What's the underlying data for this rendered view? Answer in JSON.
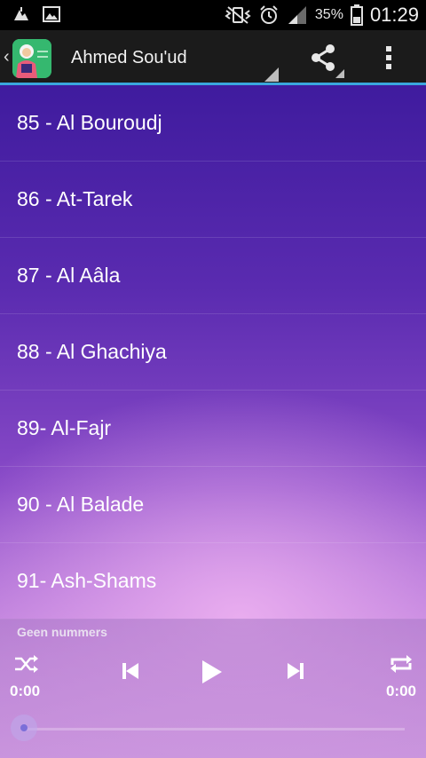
{
  "status_bar": {
    "battery_percent": "35%",
    "time": "01:29",
    "icons": [
      "download-icon",
      "image-icon",
      "vibrate-icon",
      "alarm-icon",
      "signal-icon",
      "battery-icon"
    ]
  },
  "action_bar": {
    "title": "Ahmed Sou'ud",
    "icons": [
      "app-logo-icon",
      "share-icon",
      "overflow-menu-icon"
    ]
  },
  "list": {
    "items": [
      {
        "label": "85 - Al Bouroudj"
      },
      {
        "label": "86 - At-Tarek"
      },
      {
        "label": "87 - Al Aâla"
      },
      {
        "label": "88 - Al Ghachiya"
      },
      {
        "label": "89- Al-Fajr"
      },
      {
        "label": "90 - Al Balade"
      },
      {
        "label": "91- Ash-Shams"
      }
    ]
  },
  "player": {
    "status": "Geen nummers",
    "elapsed": "0:00",
    "duration": "0:00",
    "progress": 0,
    "icons": [
      "shuffle-icon",
      "previous-icon",
      "play-icon",
      "next-icon",
      "repeat-icon"
    ]
  },
  "colors": {
    "accent": "#3aa6dd",
    "list_bg_top": "#3f1b9e",
    "list_bg_bottom": "#d9a0e6"
  }
}
